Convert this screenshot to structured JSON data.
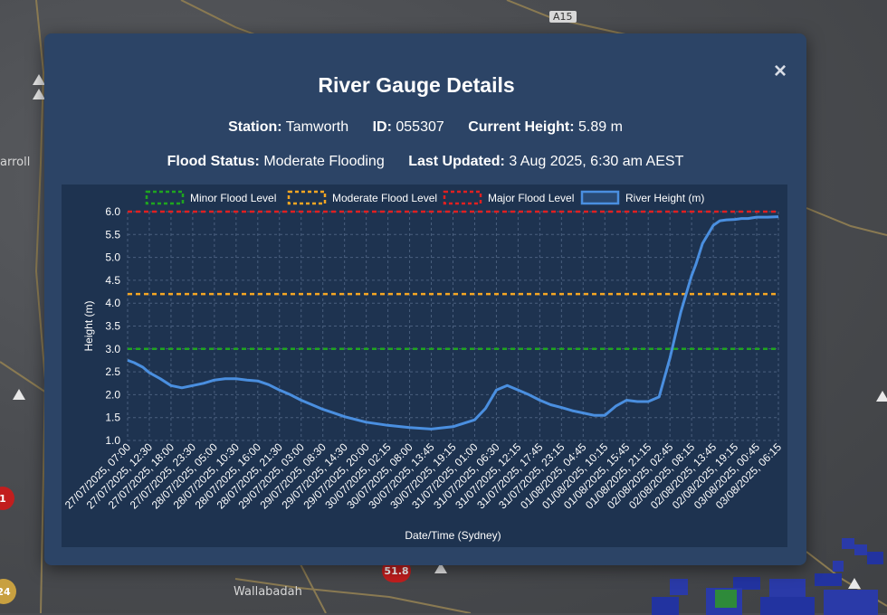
{
  "map": {
    "road_shield": "A15",
    "labels": {
      "town_left": "arroll",
      "town_bottom": "Wallabadah"
    },
    "markers": {
      "red_circle_left": "1",
      "yellow_circle_left": "24",
      "red_circle_bottom": "51.8"
    }
  },
  "modal": {
    "title": "River Gauge Details",
    "close_icon": "×",
    "station_label": "Station:",
    "station_value": "Tamworth",
    "id_label": "ID:",
    "id_value": "055307",
    "height_label": "Current Height:",
    "height_value": "5.89 m",
    "status_label": "Flood Status:",
    "status_value": "Moderate Flooding",
    "updated_label": "Last Updated:",
    "updated_value": "3 Aug 2025, 6:30 am AEST"
  },
  "chart_data": {
    "type": "line",
    "xlabel": "Date/Time (Sydney)",
    "ylabel": "Height (m)",
    "ylim": [
      1.0,
      6.0
    ],
    "yticks": [
      "6.0",
      "5.5",
      "5.0",
      "4.5",
      "4.0",
      "3.5",
      "3.0",
      "2.5",
      "2.0",
      "1.5",
      "1.0"
    ],
    "xticks": [
      "27/07/2025, 07:00",
      "27/07/2025, 12:30",
      "27/07/2025, 18:00",
      "27/07/2025, 23:30",
      "28/07/2025, 05:00",
      "28/07/2025, 10:30",
      "28/07/2025, 16:00",
      "28/07/2025, 21:30",
      "29/07/2025, 03:00",
      "29/07/2025, 08:30",
      "29/07/2025, 14:30",
      "29/07/2025, 20:00",
      "30/07/2025, 02:15",
      "30/07/2025, 08:00",
      "30/07/2025, 13:45",
      "30/07/2025, 19:15",
      "31/07/2025, 01:00",
      "31/07/2025, 06:30",
      "31/07/2025, 12:15",
      "31/07/2025, 17:45",
      "31/07/2025, 23:15",
      "01/08/2025, 04:45",
      "01/08/2025, 10:15",
      "01/08/2025, 15:45",
      "01/08/2025, 21:15",
      "02/08/2025, 02:45",
      "02/08/2025, 08:15",
      "02/08/2025, 13:45",
      "02/08/2025, 19:15",
      "03/08/2025, 00:45",
      "03/08/2025, 06:15"
    ],
    "legend_position": "top",
    "grid": true,
    "thresholds": [
      {
        "name": "Minor Flood Level",
        "value": 3.0,
        "color": "#1fa51f"
      },
      {
        "name": "Moderate Flood Level",
        "value": 4.2,
        "color": "#f5a623"
      },
      {
        "name": "Major Flood Level",
        "value": 6.0,
        "color": "#e02020"
      }
    ],
    "series": [
      {
        "name": "River Height (m)",
        "color": "#4a8fe0",
        "x": [
          0,
          0.3,
          0.7,
          1,
          1.5,
          2,
          2.5,
          3,
          3.5,
          4,
          4.5,
          5,
          5.5,
          6,
          6.5,
          7,
          7.5,
          8,
          8.5,
          9,
          9.5,
          10,
          11,
          12,
          13,
          14,
          15,
          16,
          16.5,
          17,
          17.5,
          18,
          18.5,
          19,
          19.5,
          20,
          20.5,
          21,
          21.5,
          22,
          22.5,
          23,
          23.5,
          24,
          24.5,
          25,
          25.5,
          26,
          26.2,
          26.5,
          27,
          27.3,
          27.6,
          28,
          28.3,
          28.6,
          29,
          29.5,
          30
        ],
        "values": [
          2.75,
          2.7,
          2.6,
          2.48,
          2.35,
          2.2,
          2.15,
          2.2,
          2.25,
          2.32,
          2.35,
          2.35,
          2.32,
          2.3,
          2.22,
          2.1,
          2.0,
          1.88,
          1.78,
          1.68,
          1.6,
          1.52,
          1.4,
          1.33,
          1.28,
          1.25,
          1.3,
          1.45,
          1.7,
          2.1,
          2.2,
          2.1,
          2.0,
          1.88,
          1.78,
          1.72,
          1.65,
          1.6,
          1.55,
          1.55,
          1.75,
          1.88,
          1.85,
          1.85,
          1.95,
          2.8,
          3.8,
          4.6,
          4.85,
          5.3,
          5.7,
          5.8,
          5.82,
          5.83,
          5.85,
          5.85,
          5.88,
          5.88,
          5.89
        ]
      }
    ]
  }
}
